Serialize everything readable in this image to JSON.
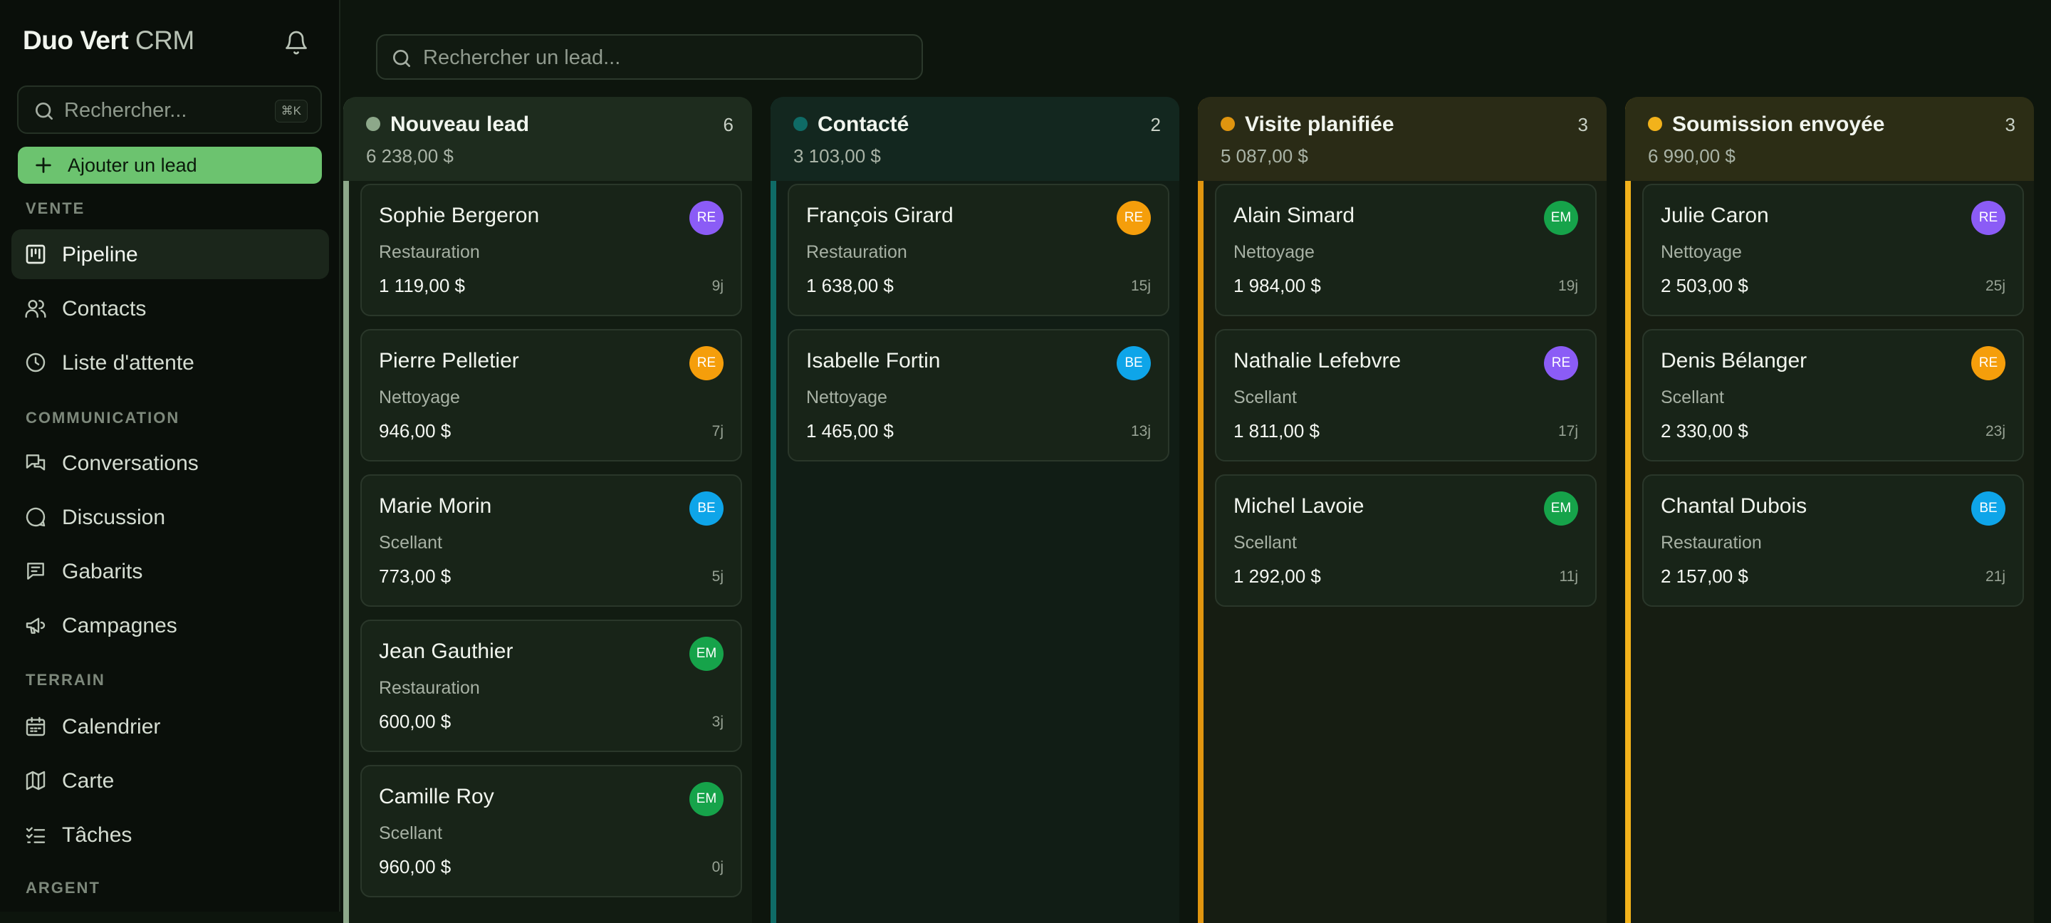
{
  "sidebar": {
    "brand_bold": "Duo Vert",
    "brand_light": "CRM",
    "search_placeholder": "Rechercher...",
    "search_shortcut": "⌘K",
    "add_button": "Ajouter un lead",
    "sections": [
      {
        "label": "VENTE",
        "items": [
          {
            "label": "Pipeline",
            "icon": "kanban-icon",
            "active": true
          },
          {
            "label": "Contacts",
            "icon": "users-icon"
          },
          {
            "label": "Liste d'attente",
            "icon": "clock-icon"
          }
        ]
      },
      {
        "label": "COMMUNICATION",
        "items": [
          {
            "label": "Conversations",
            "icon": "messages-icon"
          },
          {
            "label": "Discussion",
            "icon": "chat-bubble-icon"
          },
          {
            "label": "Gabarits",
            "icon": "template-icon"
          },
          {
            "label": "Campagnes",
            "icon": "megaphone-icon"
          }
        ]
      },
      {
        "label": "TERRAIN",
        "items": [
          {
            "label": "Calendrier",
            "icon": "calendar-icon"
          },
          {
            "label": "Carte",
            "icon": "map-icon"
          },
          {
            "label": "Tâches",
            "icon": "tasks-icon"
          }
        ]
      },
      {
        "label": "ARGENT",
        "items": []
      }
    ]
  },
  "main": {
    "search_placeholder": "Rechercher un lead..."
  },
  "colors": {
    "accent_green": "#6cc36f",
    "avatar_purple": "#8b5cf6",
    "avatar_orange": "#f59e0b",
    "avatar_blue": "#0ea5e9",
    "avatar_green": "#16a34a"
  },
  "columns": [
    {
      "title": "Nouveau lead",
      "count": "6",
      "total": "6 238,00 $",
      "color": "#8da88a",
      "head_bg": "#1e2c1e",
      "body_bg": "#121c12",
      "cards": [
        {
          "name": "Sophie Bergeron",
          "service": "Restauration",
          "amount": "1 119,00 $",
          "days": "9j",
          "initials": "RE",
          "avatar_color": "#8b5cf6"
        },
        {
          "name": "Pierre Pelletier",
          "service": "Nettoyage",
          "amount": "946,00 $",
          "days": "7j",
          "initials": "RE",
          "avatar_color": "#f59e0b"
        },
        {
          "name": "Marie Morin",
          "service": "Scellant",
          "amount": "773,00 $",
          "days": "5j",
          "initials": "BE",
          "avatar_color": "#0ea5e9"
        },
        {
          "name": "Jean Gauthier",
          "service": "Restauration",
          "amount": "600,00 $",
          "days": "3j",
          "initials": "EM",
          "avatar_color": "#16a34a"
        },
        {
          "name": "Camille Roy",
          "service": "Scellant",
          "amount": "960,00 $",
          "days": "0j",
          "initials": "EM",
          "avatar_color": "#16a34a"
        }
      ]
    },
    {
      "title": "Contacté",
      "count": "2",
      "total": "3 103,00 $",
      "color": "#0f6b66",
      "head_bg": "#13271f",
      "body_bg": "#111d15",
      "cards": [
        {
          "name": "François Girard",
          "service": "Restauration",
          "amount": "1 638,00 $",
          "days": "15j",
          "initials": "RE",
          "avatar_color": "#f59e0b"
        },
        {
          "name": "Isabelle Fortin",
          "service": "Nettoyage",
          "amount": "1 465,00 $",
          "days": "13j",
          "initials": "BE",
          "avatar_color": "#0ea5e9"
        }
      ]
    },
    {
      "title": "Visite planifiée",
      "count": "3",
      "total": "5 087,00 $",
      "color": "#e0950f",
      "head_bg": "#2a2b16",
      "body_bg": "#161d12",
      "cards": [
        {
          "name": "Alain Simard",
          "service": "Nettoyage",
          "amount": "1 984,00 $",
          "days": "19j",
          "initials": "EM",
          "avatar_color": "#16a34a"
        },
        {
          "name": "Nathalie Lefebvre",
          "service": "Scellant",
          "amount": "1 811,00 $",
          "days": "17j",
          "initials": "RE",
          "avatar_color": "#8b5cf6"
        },
        {
          "name": "Michel Lavoie",
          "service": "Scellant",
          "amount": "1 292,00 $",
          "days": "11j",
          "initials": "EM",
          "avatar_color": "#16a34a"
        }
      ]
    },
    {
      "title": "Soumission envoyée",
      "count": "3",
      "total": "6 990,00 $",
      "color": "#f2b21b",
      "head_bg": "#2c2d15",
      "body_bg": "#161d12",
      "cards": [
        {
          "name": "Julie Caron",
          "service": "Nettoyage",
          "amount": "2 503,00 $",
          "days": "25j",
          "initials": "RE",
          "avatar_color": "#8b5cf6"
        },
        {
          "name": "Denis Bélanger",
          "service": "Scellant",
          "amount": "2 330,00 $",
          "days": "23j",
          "initials": "RE",
          "avatar_color": "#f59e0b"
        },
        {
          "name": "Chantal Dubois",
          "service": "Restauration",
          "amount": "2 157,00 $",
          "days": "21j",
          "initials": "BE",
          "avatar_color": "#0ea5e9"
        }
      ]
    }
  ]
}
